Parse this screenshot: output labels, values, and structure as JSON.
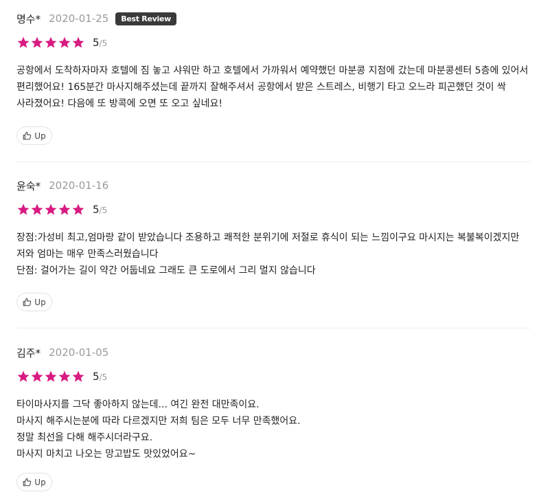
{
  "colors": {
    "star": "#d81b81",
    "badge_bg": "#3a3a3a",
    "date": "#9a9a9a"
  },
  "reviews": [
    {
      "author": "명수*",
      "date": "2020-01-25",
      "badge": "Best Review",
      "rating": 5,
      "rating_value": "5",
      "rating_max": "/5",
      "lines": [
        "공항에서 도착하자마자 호텔에 짐 놓고 샤워만 하고 호텔에서 가까워서 예약했던 마분콩 지점에 갔는데 마분콩센터 5층에 있어서 편리했어요! 165분간 마사지해주셨는데 끝까지 잘해주셔서 공항에서 받은 스트레스, 비행기 타고 오느라 피곤했던 것이 싹 사라졌어요! 다음에 또 방콕에 오면 또 오고 싶네요!"
      ],
      "up_label": "Up"
    },
    {
      "author": "윤숙*",
      "date": "2020-01-16",
      "rating": 5,
      "rating_value": "5",
      "rating_max": "/5",
      "lines": [
        "장점:가성비 최고,엄마랑 같이 받았습니다 조용하고 쾌적한 분위기에 저절로 휴식이 되는 느낌이구요 마시지는 복불복이겠지만 저와 엄마는 매우 만족스러웠습니다",
        "단점: 걸어가는 길이 약간 어둡네요 그래도 큰 도로에서 그리 멀지 않습니다"
      ],
      "up_label": "Up"
    },
    {
      "author": "김주*",
      "date": "2020-01-05",
      "rating": 5,
      "rating_value": "5",
      "rating_max": "/5",
      "lines": [
        "타이마사지를 그닥 좋아하지 않는데... 여긴 완전 대만족이요.",
        "마사지 해주시는분에 따라 다르겠지만 저희 팀은 모두 너무 만족했어요.",
        "정말 최선을 다해 해주시더라구요.",
        "마사지 마치고 나오는 망고밥도 맛있었어요~"
      ],
      "up_label": "Up"
    }
  ]
}
